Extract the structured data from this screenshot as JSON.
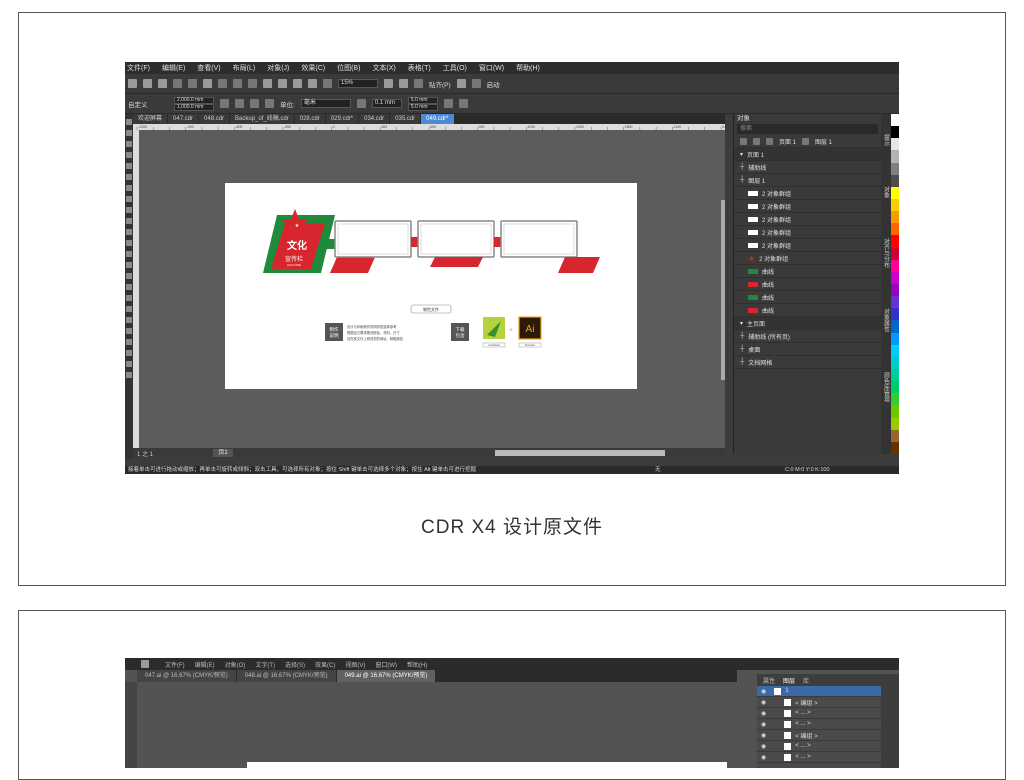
{
  "top_app": {
    "menu": [
      "文件(F)",
      "编辑(E)",
      "查看(V)",
      "布局(L)",
      "对象(J)",
      "效果(C)",
      "位图(B)",
      "文本(X)",
      "表格(T)",
      "工具(O)",
      "窗口(W)",
      "帮助(H)"
    ],
    "zoom": "15%",
    "paste_label": "贴齐(P)",
    "launch_label": "启动",
    "width_value": "2,000.0 mm",
    "height_value": "1,000.0 mm",
    "preset": "自定义",
    "unit_label": "单位:",
    "unit_value": "毫米",
    "nudge_value": "0.1 mm",
    "dup_x": "5.0 mm",
    "dup_y": "5.0 mm",
    "tabs": [
      "欢迎屏幕",
      "047.cdr",
      "048.cdr",
      "Backup_of_线稿.cdr",
      "028.cdr",
      "029.cdr*",
      "034.cdr",
      "035.cdr",
      "049.cdr*"
    ],
    "active_tab_index": 8,
    "ruler_ticks": [
      "-1200",
      "-1100",
      "-1000",
      "-900",
      "-800",
      "-700",
      "-600",
      "-500",
      "-400",
      "-300",
      "-200",
      "-100",
      "0",
      "100",
      "200",
      "300",
      "400",
      "500",
      "600",
      "700",
      "800",
      "900",
      "1000",
      "1100",
      "1200",
      "1300",
      "1400",
      "1500",
      "1600",
      "1700",
      "1800",
      "1900",
      "2000",
      "2100",
      "2200",
      "2300",
      "2400"
    ],
    "status_text": "接着单击可进行拖动或缩放；再单击可旋转或倾斜；双击工具，可选择所有对象；按住 Shift 键单击可选择多个对象；按住 Alt 键单击可进行挖掘",
    "status_color": "C:0 M:0 Y:0 K:100",
    "fill_label": "无",
    "page_tab": "页1",
    "page_counter": "1 之 1",
    "design": {
      "title": "文化",
      "subtitle": "宣传栏",
      "title_small": "CULTURE",
      "button": "钢色文件",
      "make_label": "制作\n说明",
      "notes": [
        "设计与印刷制作说明供您选择参考",
        "根据自己需求更改颜色、材料、尺寸",
        "请在软文件上修改您的网址、邮箱报告"
      ],
      "download_label": "下载\n包含",
      "file_label_1": "CorelDraw",
      "file_label_2": "Illustrator",
      "ai_label": "Ai",
      "red": "#d7262d",
      "green": "#1f8a3c"
    },
    "panel": {
      "title": "对象",
      "search_placeholder": "搜索",
      "page_label": "页面 1",
      "layer_label": "图层 1",
      "rows": [
        {
          "label": "页面 1",
          "type": "section"
        },
        {
          "label": "辅助线",
          "type": "item"
        },
        {
          "label": "图层 1",
          "type": "item"
        },
        {
          "label": "2 对象群组",
          "type": "group"
        },
        {
          "label": "2 对象群组",
          "type": "group"
        },
        {
          "label": "2 对象群组",
          "type": "group"
        },
        {
          "label": "2 对象群组",
          "type": "group"
        },
        {
          "label": "2 对象群组",
          "type": "group"
        },
        {
          "label": "2 对象群组",
          "type": "star"
        },
        {
          "label": "曲线",
          "type": "curve"
        },
        {
          "label": "曲线",
          "type": "curve"
        },
        {
          "label": "曲线",
          "type": "curve"
        },
        {
          "label": "曲线",
          "type": "curve"
        },
        {
          "label": "主页面",
          "type": "section"
        },
        {
          "label": "辅助线 (所有页)",
          "type": "item"
        },
        {
          "label": "桌面",
          "type": "item"
        },
        {
          "label": "文档网格",
          "type": "item"
        }
      ],
      "side_tabs": [
        "提示",
        "对象",
        "对齐与分布",
        "对象属性",
        "颜色库管理"
      ]
    },
    "palette": [
      "#ffffff",
      "#000000",
      "#e6e6e6",
      "#b3b3b3",
      "#808080",
      "#4d4d4d",
      "#ffff00",
      "#ffcc00",
      "#ff9900",
      "#ff6600",
      "#ff0000",
      "#cc0033",
      "#ff0099",
      "#cc00cc",
      "#9900cc",
      "#6633cc",
      "#3333cc",
      "#0066cc",
      "#0099ff",
      "#00ccff",
      "#00cccc",
      "#00cc99",
      "#00cc66",
      "#33cc33",
      "#66cc00",
      "#99cc00",
      "#996633",
      "#663300"
    ]
  },
  "caption": "CDR X4 设计原文件",
  "bottom_app": {
    "menu": [
      "文件(F)",
      "编辑(E)",
      "对象(O)",
      "文字(T)",
      "选择(S)",
      "效果(C)",
      "视图(V)",
      "窗口(W)",
      "帮助(H)"
    ],
    "tabs": [
      "047.ai @ 16.67% (CMYK/预览)",
      "048.ai @ 16.67% (CMYK/预览)",
      "049.ai @ 16.67% (CMYK/预览)"
    ],
    "active_tab_index": 2,
    "panel_tabs": [
      "属性",
      "图层",
      "库"
    ],
    "layer_rows": [
      "1",
      "< 编组 >",
      "< ... >",
      "< ... >",
      "< 编组 >",
      "< ... >",
      "< ... >"
    ]
  }
}
